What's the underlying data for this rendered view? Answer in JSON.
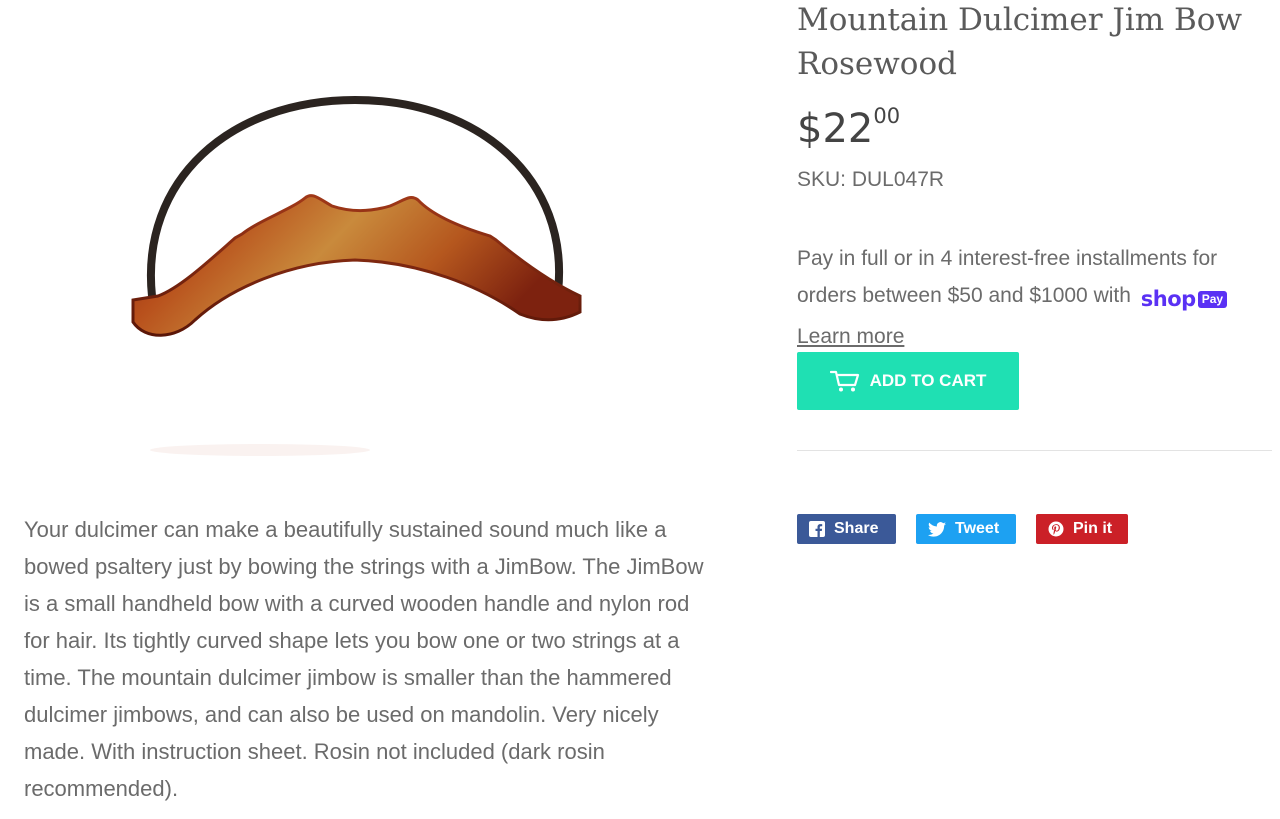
{
  "product": {
    "title": "Mountain Dulcimer Jim Bow Rosewood",
    "price_dollars": "$22",
    "price_cents": "00",
    "sku": "SKU: DUL047R",
    "image_alt": "Mountain dulcimer Jim Bow with rosewood handle",
    "description": "Your dulcimer can make a beautifully sustained sound much like a bowed psaltery just by bowing the strings with a JimBow. The JimBow is a small handheld bow with a curved wooden handle and nylon rod for hair. Its tightly curved shape lets you bow one or two strings at a time. The mountain dulcimer jimbow is smaller than the hammered dulcimer jimbows, and can also be used on mandolin. Very nicely made. With instruction sheet. Rosin not included (dark rosin recommended)."
  },
  "installments": {
    "text": "Pay in full or in 4 interest-free installments for orders between $50 and $1000 with",
    "shop_word": "shop",
    "pay_pill": "Pay",
    "learn_more": "Learn more"
  },
  "cart": {
    "label": "ADD TO CART",
    "icon": "cart-icon",
    "color": "#1fe0b3"
  },
  "share": [
    {
      "label": "Share",
      "icon": "facebook-icon",
      "color": "#3b5998"
    },
    {
      "label": "Tweet",
      "icon": "twitter-icon",
      "color": "#1da1f2"
    },
    {
      "label": "Pin it",
      "icon": "pinterest-icon",
      "color": "#cb2027"
    }
  ]
}
